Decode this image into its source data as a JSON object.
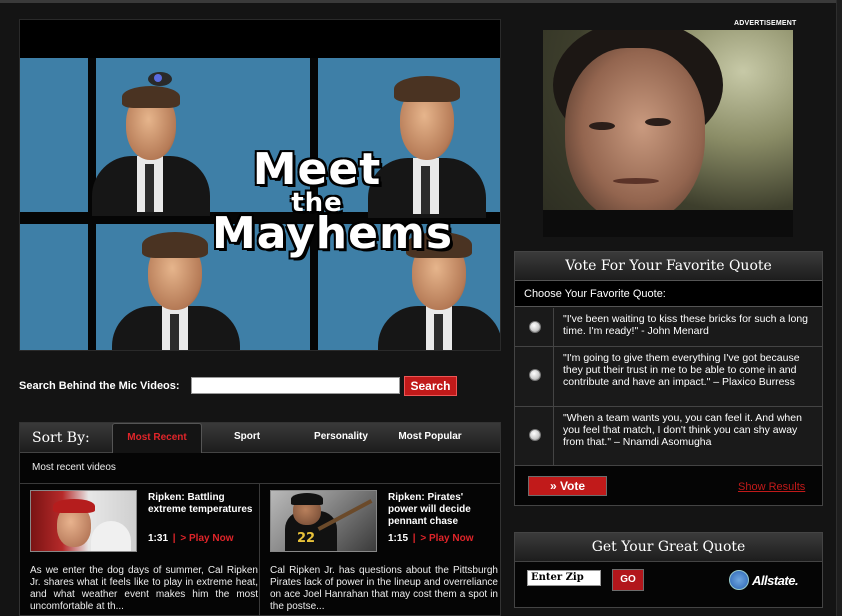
{
  "video": {
    "title_line1": "Meet",
    "title_line2": "the",
    "title_line3": "Mayhems"
  },
  "search": {
    "label": "Search Behind the Mic Videos:",
    "value": "",
    "placeholder": "",
    "button": "Search"
  },
  "sort": {
    "label": "Sort By:",
    "tabs": [
      "Most Recent",
      "Sport",
      "Personality",
      "Most Popular"
    ],
    "active_tab": "Most Recent",
    "subtitle": "Most recent videos"
  },
  "videos": [
    {
      "title": "Ripken: Battling extreme temperatures",
      "duration": "1:31",
      "separator": "|",
      "play": "> Play Now",
      "description": "As we enter the dog days of summer, Cal Ripken Jr. shares what it feels like to play in extreme heat, and what weather event makes him the most uncomfortable at th..."
    },
    {
      "title": "Ripken: Pirates' power will decide pennant chase",
      "duration": "1:15",
      "separator": "|",
      "play": "> Play Now",
      "description": "Cal Ripken Jr. has questions about the Pittsburgh Pirates lack of power in the lineup and overreliance on ace Joel Hanrahan that may cost them a spot in the postse..."
    }
  ],
  "ad": {
    "label": "ADVERTISEMENT"
  },
  "vote": {
    "header": "Vote For Your Favorite Quote",
    "subheader": "Choose Your Favorite Quote:",
    "options": [
      "\"I've been waiting to kiss these bricks for such a long time. I'm ready!\" - John Menard",
      "\"I'm going to give them everything I've got because they put their trust in me to be able to come in and contribute and have an impact.\" – Plaxico Burress",
      "\"When a team wants you, you can feel it. And when you feel that match, I don't think you can shy away from that.\" – Nnamdi Asomugha"
    ],
    "button": "» Vote",
    "results_link": "Show Results"
  },
  "quote": {
    "header": "Get Your Great Quote",
    "zip_value": "Enter Zip",
    "go_button": "GO",
    "brand": "Allstate."
  },
  "colors": {
    "accent_red": "#c11a1a",
    "background": "#141414",
    "video_bg": "#3e7fa7"
  }
}
